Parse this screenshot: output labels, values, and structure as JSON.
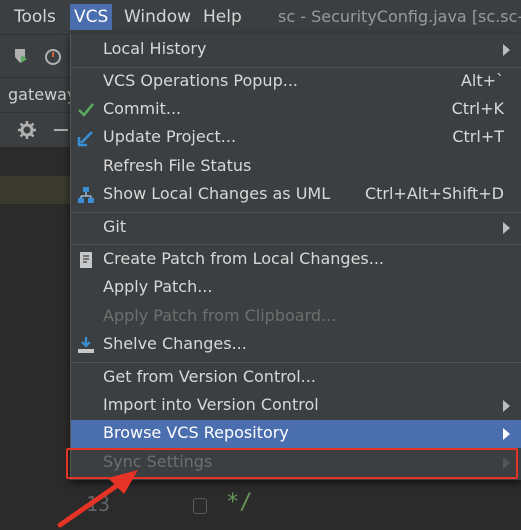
{
  "menubar": {
    "items": [
      "Tools",
      "VCS",
      "Window",
      "Help"
    ],
    "title": "sc - SecurityConfig.java [sc.sc-a"
  },
  "sidebar": {
    "tab_label": "gateway"
  },
  "editor": {
    "line_number": "13",
    "code": "*/"
  },
  "vcs_menu": {
    "items": [
      {
        "label": "Local History",
        "shortcut": "",
        "submenu": true
      },
      {
        "label": "VCS Operations Popup...",
        "shortcut": "Alt+`"
      },
      {
        "label": "Commit...",
        "shortcut": "Ctrl+K",
        "icon": "check-icon"
      },
      {
        "label": "Update Project...",
        "shortcut": "Ctrl+T",
        "icon": "update-arrow-icon"
      },
      {
        "label": "Refresh File Status",
        "shortcut": ""
      },
      {
        "label": "Show Local Changes as UML",
        "shortcut": "Ctrl+Alt+Shift+D",
        "icon": "uml-icon"
      },
      {
        "label": "Git",
        "shortcut": "",
        "submenu": true
      },
      {
        "label": "Create Patch from Local Changes...",
        "shortcut": "",
        "icon": "patch-icon"
      },
      {
        "label": "Apply Patch...",
        "shortcut": ""
      },
      {
        "label": "Apply Patch from Clipboard...",
        "shortcut": "",
        "disabled": true
      },
      {
        "label": "Shelve Changes...",
        "shortcut": "",
        "icon": "shelve-icon"
      },
      {
        "label": "Get from Version Control...",
        "shortcut": ""
      },
      {
        "label": "Import into Version Control",
        "shortcut": "",
        "submenu": true
      },
      {
        "label": "Browse VCS Repository",
        "shortcut": "",
        "submenu": true,
        "selected": true
      },
      {
        "label": "Sync Settings",
        "shortcut": "",
        "submenu": true,
        "disabled": true
      }
    ]
  },
  "colors": {
    "selection": "#4b6eaf",
    "annotation": "#e53326",
    "commit_check": "#5aa95e",
    "update_arrow": "#3b8fd6"
  }
}
